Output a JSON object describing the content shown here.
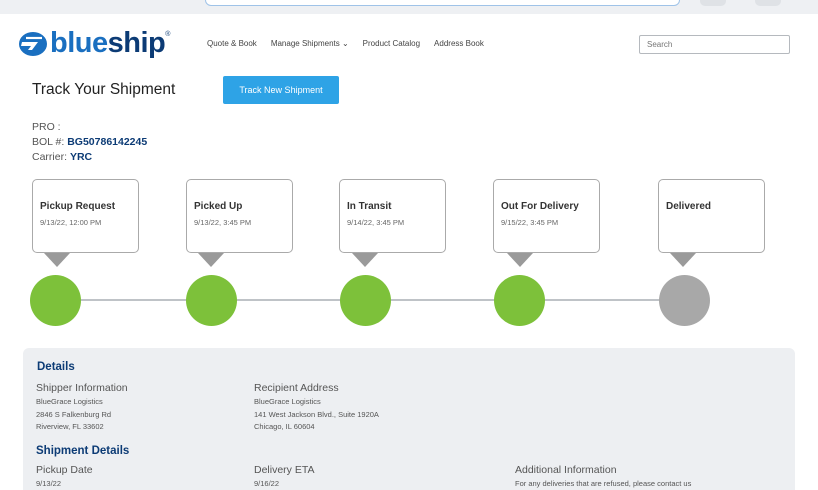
{
  "brand": {
    "name_part1": "blue",
    "name_part2": "ship",
    "mark": "®",
    "primary_color": "#1a6fc0",
    "dark_color": "#0c3b75"
  },
  "nav": {
    "items": [
      {
        "label": "Quote & Book"
      },
      {
        "label": "Manage Shipments ⌄"
      },
      {
        "label": "Product Catalog"
      },
      {
        "label": "Address Book"
      }
    ],
    "search_placeholder": "Search"
  },
  "page": {
    "title": "Track Your Shipment",
    "track_button": "Track New Shipment"
  },
  "shipment": {
    "pro_label": "PRO :",
    "pro_value": "",
    "bol_label": "BOL #:",
    "bol_value": "BG50786142245",
    "carrier_label": "Carrier:",
    "carrier_value": "YRC"
  },
  "stages": [
    {
      "name": "Pickup Request",
      "date": "9/13/22, 12:00 PM",
      "status": "complete"
    },
    {
      "name": "Picked Up",
      "date": "9/13/22, 3:45 PM",
      "status": "complete"
    },
    {
      "name": "In Transit",
      "date": "9/14/22, 3:45 PM",
      "status": "complete"
    },
    {
      "name": "Out For Delivery",
      "date": "9/15/22, 3:45 PM",
      "status": "complete"
    },
    {
      "name": "Delivered",
      "date": "",
      "status": "pending"
    }
  ],
  "colors": {
    "complete": "#7dc13a",
    "pending": "#a8a8a8",
    "button": "#2ea3e6"
  },
  "details": {
    "heading": "Details",
    "shipper_label": "Shipper Information",
    "shipper_lines": [
      "BlueGrace Logistics",
      "2846 S Falkenburg Rd",
      "Riverview, FL 33602"
    ],
    "recipient_label": "Recipient Address",
    "recipient_lines": [
      "BlueGrace Logistics",
      "141 West Jackson Blvd., Suite 1920A",
      "Chicago, IL 60604"
    ],
    "shipment_heading": "Shipment Details",
    "pickup_label": "Pickup Date",
    "pickup_value": "9/13/22",
    "delivery_label": "Delivery ETA",
    "delivery_value": "9/16/22",
    "additional_label": "Additional Information",
    "additional_value": "For any deliveries that are refused, please contact us"
  }
}
